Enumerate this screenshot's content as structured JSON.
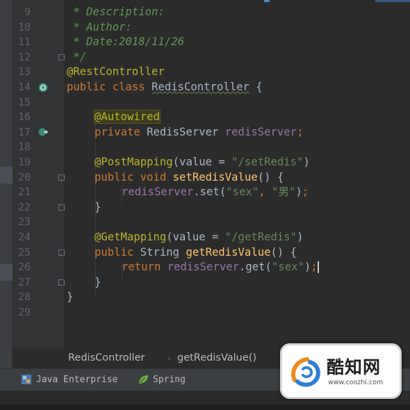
{
  "gutter": {
    "line_numbers": [
      "9",
      "10",
      "11",
      "12",
      "13",
      "14",
      "15",
      "16",
      "17",
      "18",
      "19",
      "20",
      "21",
      "22",
      "23",
      "24",
      "25",
      "26",
      "27",
      "28",
      "29"
    ]
  },
  "code": {
    "l9_comment": " * Description:",
    "l10_comment": " * Author:",
    "l11_comment": " * Date:2018/11/26",
    "l12_comment": " */",
    "l13_annotation": "@RestController",
    "l14_kw": "public class ",
    "l14_name": "RedisController",
    "l14_rest": " {",
    "l16_annotation": "@Autowired",
    "l17_kw": "private ",
    "l17_type": "RedisServer ",
    "l17_field": "redisServer",
    "l17_end": ";",
    "l19_annotation": "@PostMapping",
    "l19_open": "(value = ",
    "l19_str": "\"/setRedis\"",
    "l19_close": ")",
    "l20_kw": "public void ",
    "l20_method": "setRedisValue",
    "l20_rest": "() {",
    "l21_field": "redisServer",
    "l21_call": ".set(",
    "l21_str1": "\"sex\"",
    "l21_comma": ", ",
    "l21_str2": "\"男\"",
    "l21_close": ")",
    "l21_end": ";",
    "l22_brace": "}",
    "l24_annotation": "@GetMapping",
    "l24_open": "(value = ",
    "l24_str": "\"/getRedis\"",
    "l24_close": ")",
    "l25_kw": "public ",
    "l25_type": "String ",
    "l25_method": "getRedisValue",
    "l25_rest": "() {",
    "l26_kw": "return ",
    "l26_field": "redisServer",
    "l26_call": ".get(",
    "l26_str": "\"sex\"",
    "l26_close": ")",
    "l26_end": ";",
    "l27_brace": "}",
    "l28_brace": "}"
  },
  "breadcrumb": {
    "class_name": "RedisController",
    "separator": "›",
    "method_name": "getRedisValue()"
  },
  "bottombar": {
    "java_enterprise": "Java Enterprise",
    "spring": "Spring"
  },
  "watermark": {
    "brand": "酷知网",
    "url": "www.coozhi.com"
  },
  "colors": {
    "background": "#2b2b2b",
    "keyword": "#cc7832",
    "annotation": "#bbb529",
    "string": "#6a8759",
    "comment": "#629755",
    "field": "#9876aa",
    "method": "#ffc66d"
  }
}
